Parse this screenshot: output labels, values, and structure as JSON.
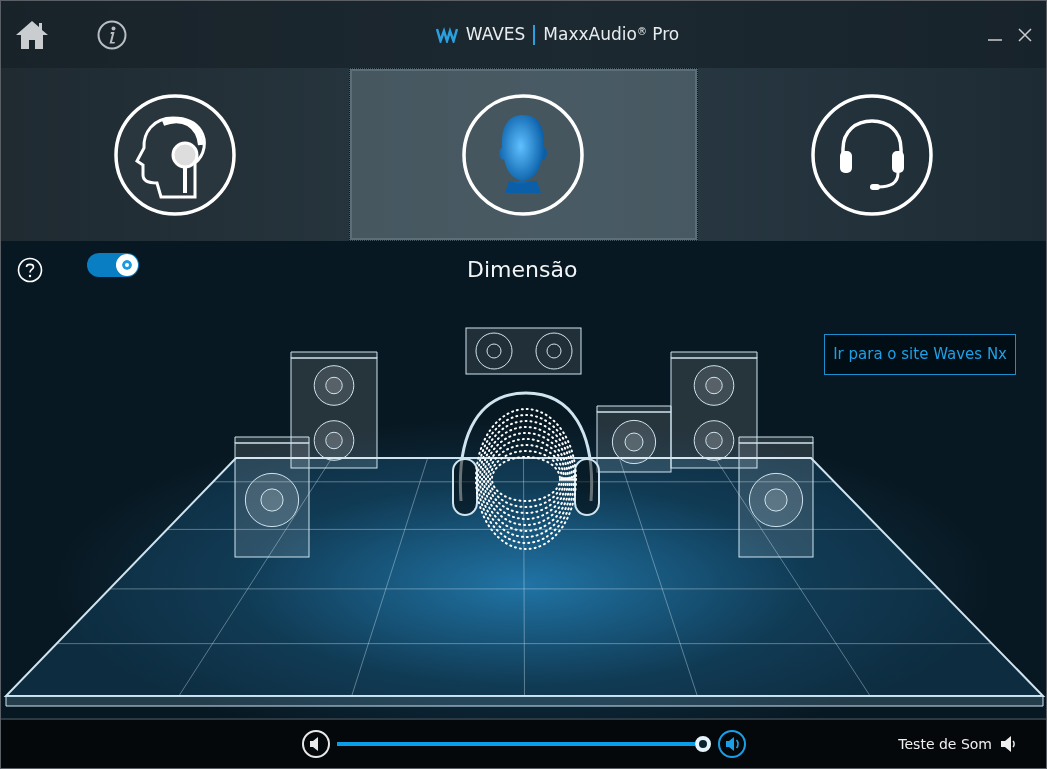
{
  "window": {
    "brand": "WAVES",
    "title": "MaxxAudio$^{®}$ Pro"
  },
  "modes": [
    {
      "kind": "headphones",
      "selected": false
    },
    {
      "kind": "head3d",
      "selected": true
    },
    {
      "kind": "headset",
      "selected": false
    }
  ],
  "toggle": {
    "on": true
  },
  "section_title": "Dimensão",
  "link_button": "Ir para o site Waves Nx",
  "volume": {
    "level": 1.0
  },
  "sound_test": "Teste de Som"
}
